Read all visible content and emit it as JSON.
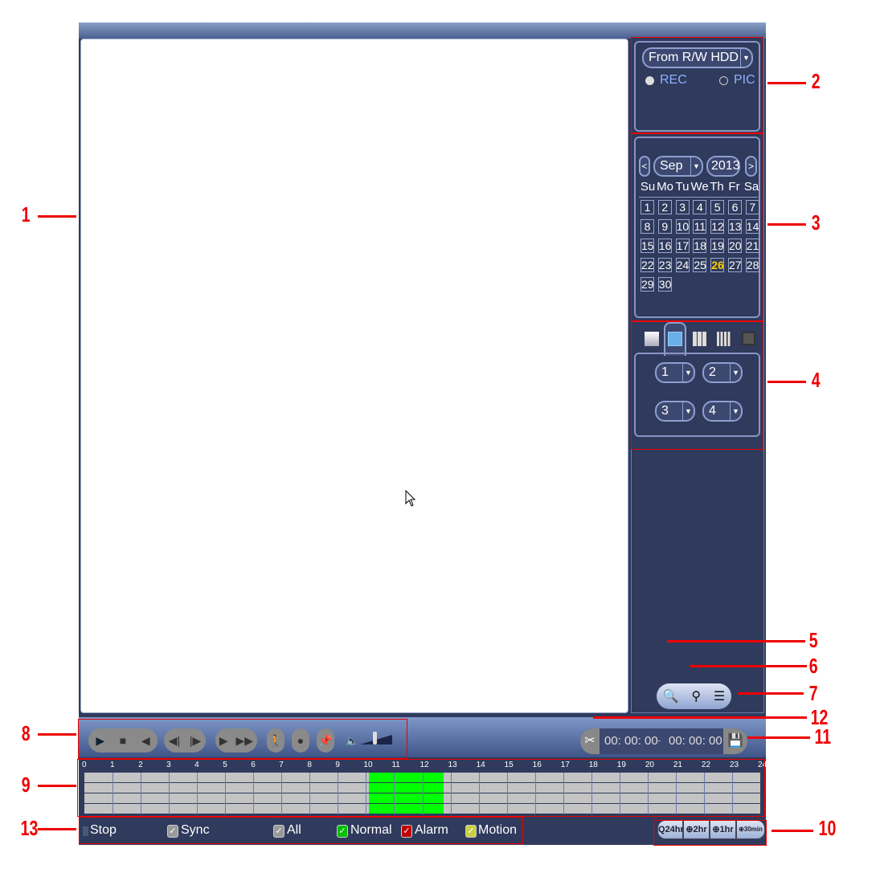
{
  "source": {
    "selected": "From R/W HDD",
    "options": [
      {
        "label": "REC",
        "selected": true
      },
      {
        "label": "PIC",
        "selected": false
      }
    ]
  },
  "calendar": {
    "month": "Sep",
    "year": "2013",
    "prev": "<",
    "next": ">",
    "weekdays": [
      "Su",
      "Mo",
      "Tu",
      "We",
      "Th",
      "Fr",
      "Sa"
    ],
    "first_weekday": 0,
    "days": 30,
    "today": 26,
    "today_color": "#ffcc00"
  },
  "layout": {
    "modes": [
      "1-window",
      "4-window",
      "9-window",
      "16-window",
      "full-screen"
    ],
    "active": "4-window",
    "channels": [
      "1",
      "2",
      "3",
      "4"
    ]
  },
  "side_buttons": [
    "search-icon",
    "smart-search-icon",
    "file-list-icon"
  ],
  "clip": {
    "start": "00: 00: 00",
    "sep": "-",
    "end": "00: 00: 00"
  },
  "controls": [
    "play",
    "stop",
    "reverse-play",
    "previous-frame",
    "next-frame",
    "slow",
    "fast",
    "smart-search",
    "snapshot",
    "mark",
    "volume"
  ],
  "timeline": {
    "hours": [
      "0",
      "1",
      "2",
      "3",
      "4",
      "5",
      "6",
      "7",
      "8",
      "9",
      "10",
      "11",
      "12",
      "13",
      "14",
      "15",
      "16",
      "17",
      "18",
      "19",
      "20",
      "21",
      "22",
      "23",
      "24"
    ],
    "channels": 4,
    "recording": [
      {
        "start": 10.1,
        "end": 12.75,
        "type": "Normal",
        "color": "#00ff00"
      }
    ]
  },
  "bottom": {
    "stop": "Stop",
    "sync": "Sync",
    "all": "All",
    "normal": "Normal",
    "alarm": "Alarm",
    "motion": "Motion",
    "colors": {
      "normal": "#00c000",
      "alarm": "#c00000",
      "motion": "#c8d040"
    }
  },
  "zoom": [
    "24hr",
    "2hr",
    "1hr",
    "30min"
  ],
  "callouts": [
    "1",
    "2",
    "3",
    "4",
    "5",
    "6",
    "7",
    "8",
    "9",
    "10",
    "11",
    "12",
    "13"
  ]
}
